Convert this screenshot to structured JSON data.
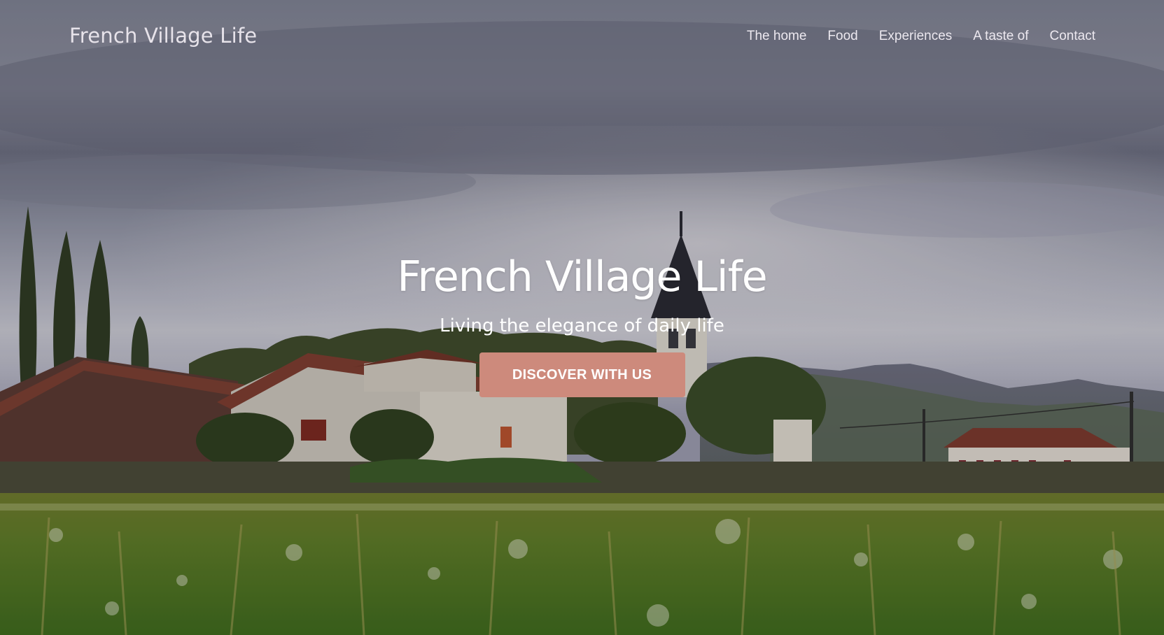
{
  "site": {
    "brand": "French Village Life"
  },
  "nav": {
    "items": [
      {
        "label": "The home"
      },
      {
        "label": "Food"
      },
      {
        "label": "Experiences"
      },
      {
        "label": "A taste of"
      },
      {
        "label": "Contact"
      }
    ]
  },
  "hero": {
    "title": "French Village Life",
    "subtitle": "Living the elegance of daily life",
    "cta_label": "DISCOVER WITH US"
  },
  "colors": {
    "accent": "#cd8a7c",
    "text_light": "#ffffff"
  }
}
